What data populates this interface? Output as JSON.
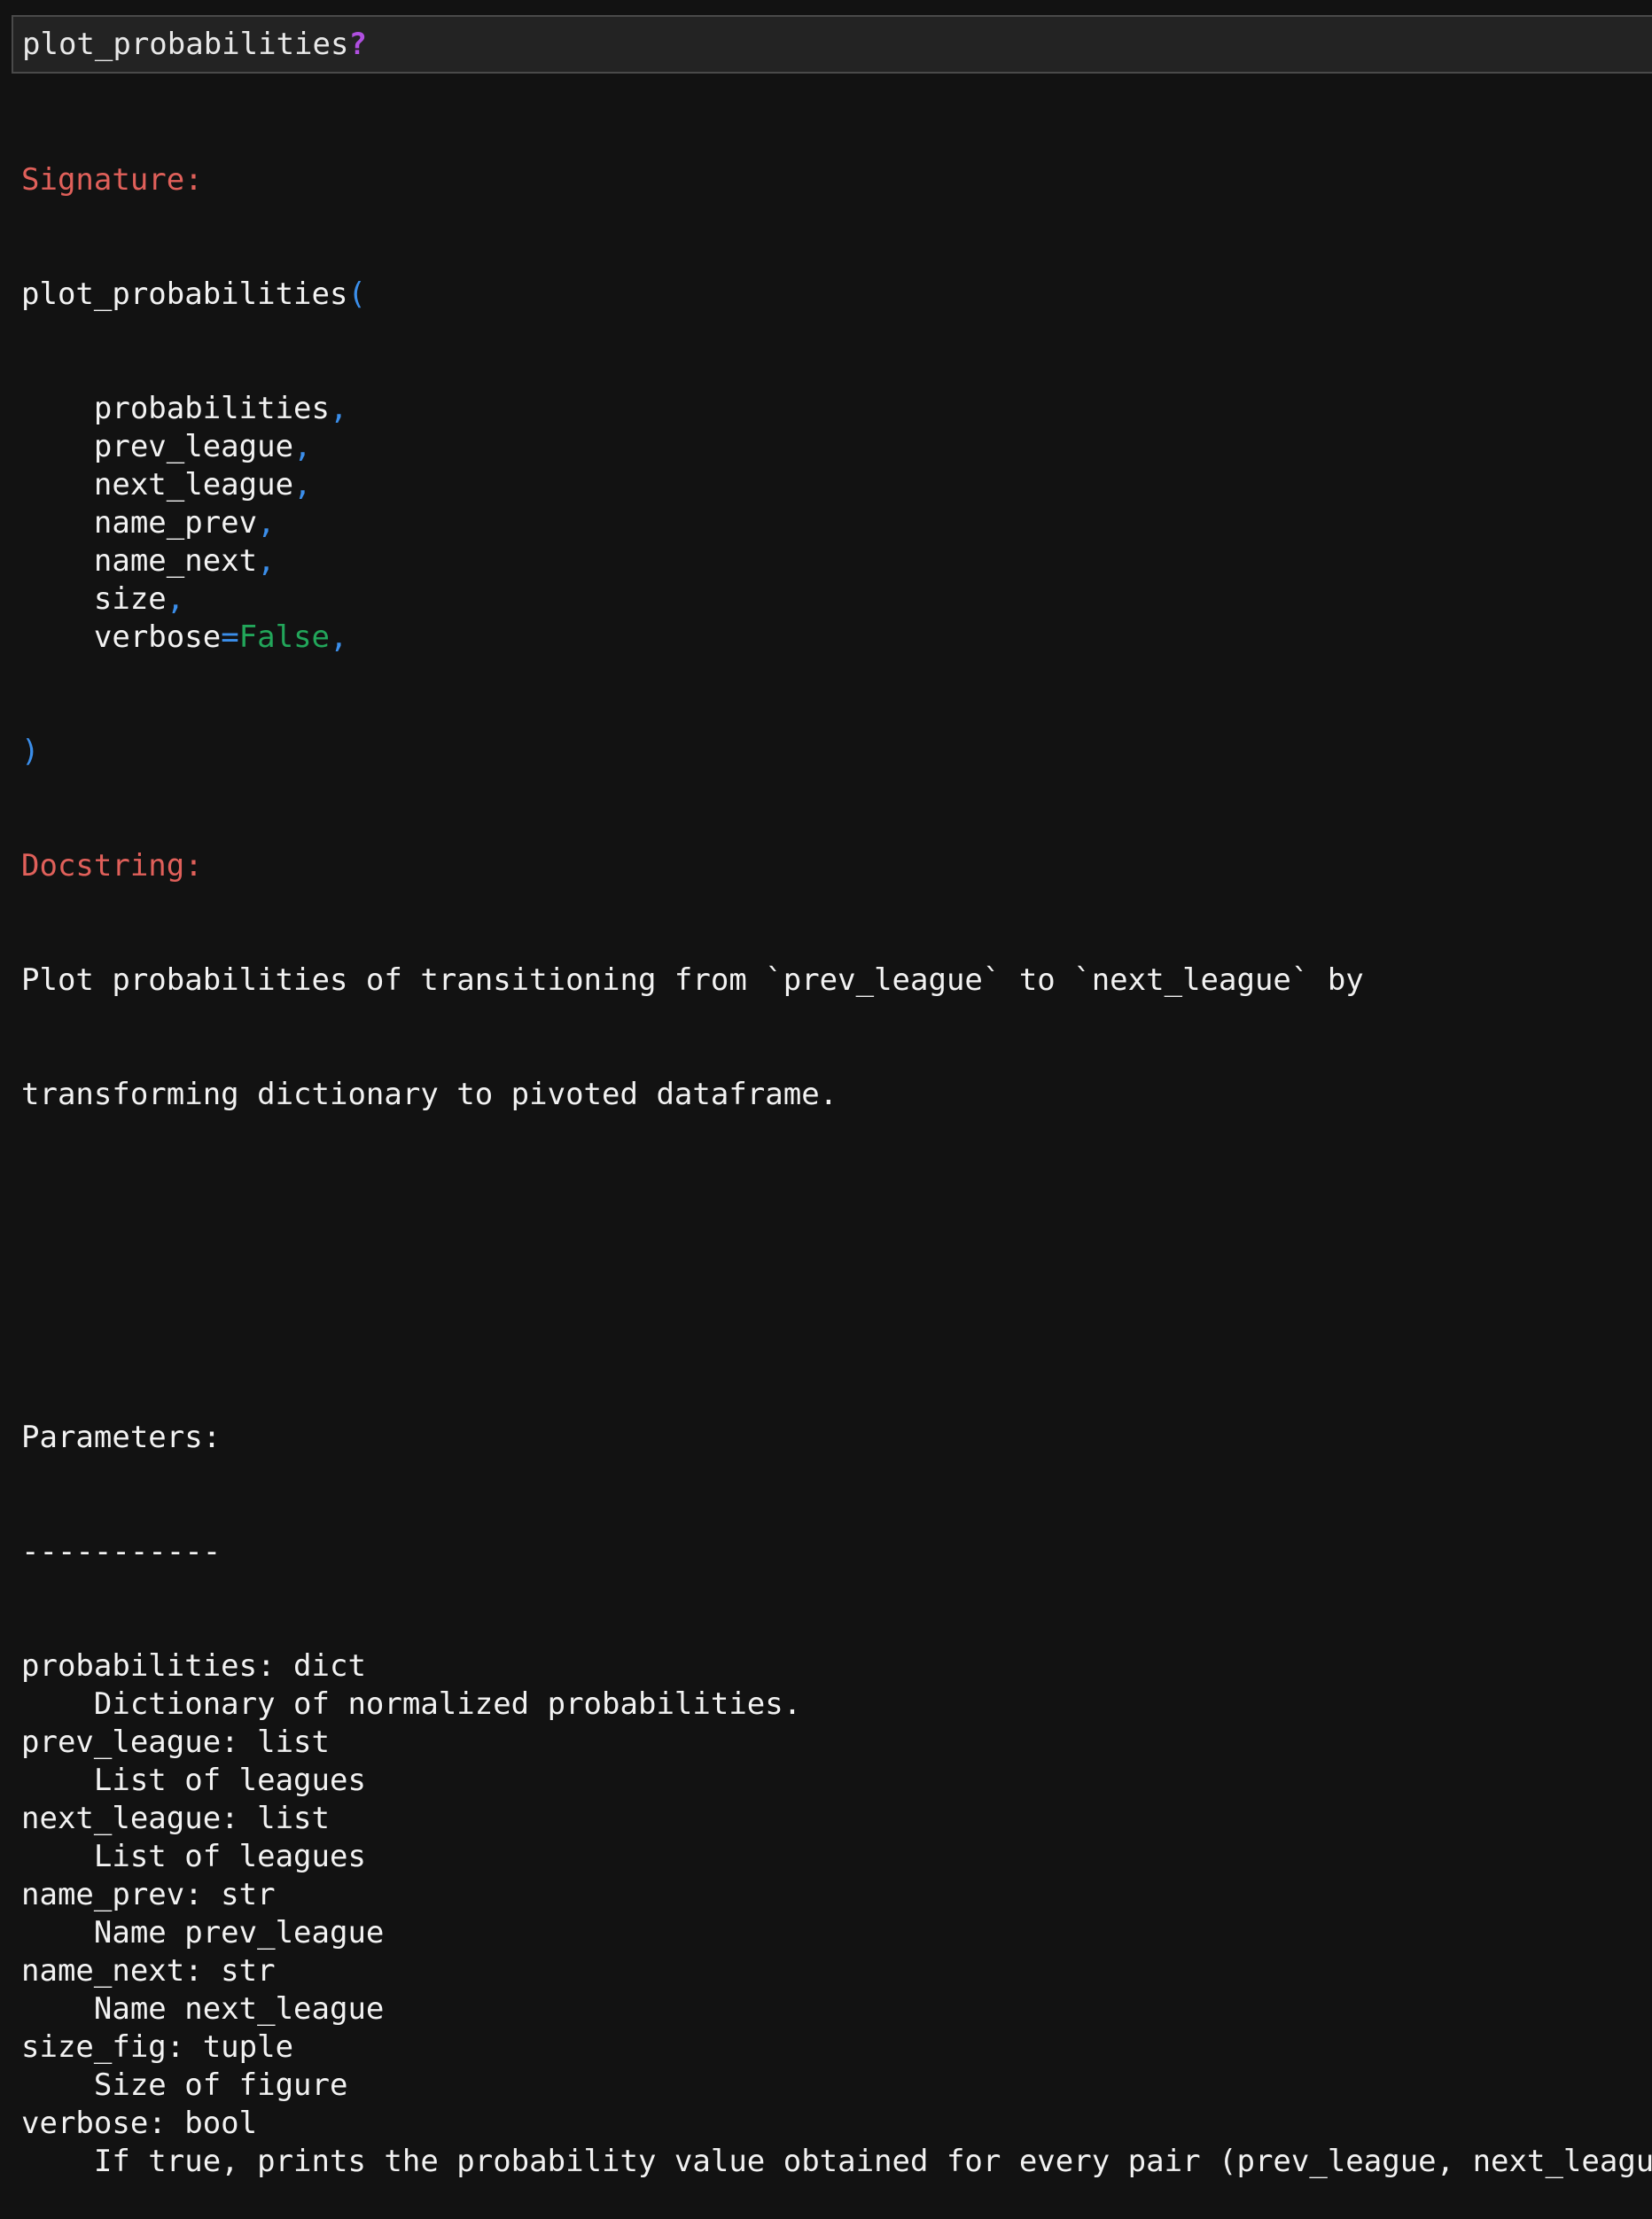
{
  "input": {
    "code": "plot_probabilities",
    "help_operator": "?"
  },
  "signature": {
    "header": "Signature:",
    "function_name": "plot_probabilities",
    "open_paren": "(",
    "close_paren": ")",
    "comma": ",",
    "indent": "    ",
    "params": [
      {
        "name": "probabilities"
      },
      {
        "name": "prev_league"
      },
      {
        "name": "next_league"
      },
      {
        "name": "name_prev"
      },
      {
        "name": "name_next"
      },
      {
        "name": "size"
      },
      {
        "name": "verbose",
        "equals": "=",
        "default": "False"
      }
    ]
  },
  "docstring": {
    "header": "Docstring:",
    "summary": [
      "Plot probabilities of transitioning from `prev_league` to `next_league` by",
      "transforming dictionary to pivoted dataframe."
    ],
    "parameters_title": "Parameters:",
    "underline": "-----------",
    "params": [
      {
        "decl": "probabilities: dict",
        "desc": "    Dictionary of normalized probabilities."
      },
      {
        "decl": "prev_league: list",
        "desc": "    List of leagues"
      },
      {
        "decl": "next_league: list",
        "desc": "    List of leagues"
      },
      {
        "decl": "name_prev: str",
        "desc": "    Name prev_league"
      },
      {
        "decl": "name_next: str",
        "desc": "    Name next_league"
      },
      {
        "decl": "size_fig: tuple",
        "desc": "    Size of figure"
      },
      {
        "decl": "verbose: bool",
        "desc": "    If true, prints the probability value obtained for every pair (prev_league, next_league)"
      }
    ]
  },
  "colors": {
    "background": "#121212",
    "input_background": "#232323",
    "header": "#e0605a",
    "punctuation": "#3b8eea",
    "literal": "#22a65a",
    "help_operator": "#b04fe0",
    "text": "#f2f2f2"
  }
}
